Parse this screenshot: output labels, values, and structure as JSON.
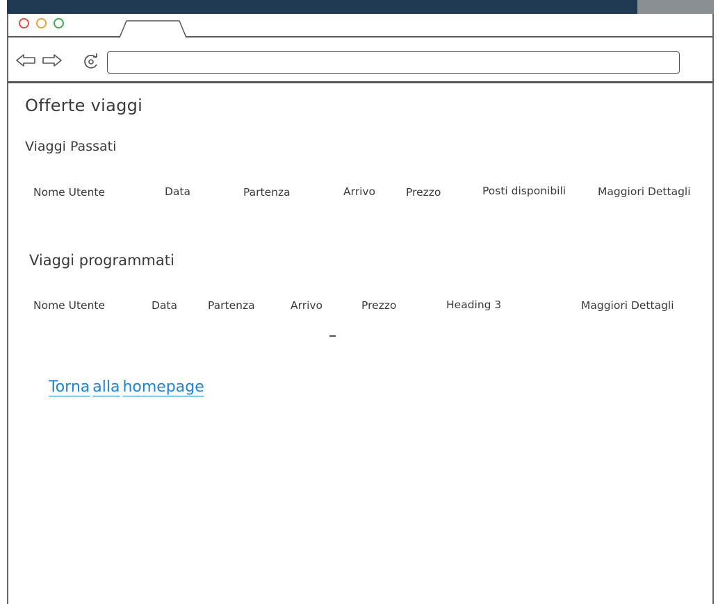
{
  "browser": {
    "address_value": ""
  },
  "page": {
    "title": "Offerte viaggi"
  },
  "past_trips": {
    "heading": "Viaggi Passati",
    "columns": [
      "Nome Utente",
      "Data",
      "Partenza",
      "Arrivo",
      "Prezzo",
      "Posti disponibili",
      "Maggiori Dettagli"
    ]
  },
  "scheduled_trips": {
    "heading": "Viaggi programmati",
    "columns": [
      "Nome Utente",
      "Data",
      "Partenza",
      "Arrivo",
      "Prezzo",
      "Heading 3",
      "Maggiori Dettagli"
    ]
  },
  "footer_link": {
    "words": [
      "Torna",
      "alla",
      "homepage"
    ]
  },
  "colors": {
    "link": "#1e83d6",
    "close_dot": "#e0503a",
    "minimize_dot": "#e6a23b",
    "maximize_dot": "#3fa84a"
  }
}
